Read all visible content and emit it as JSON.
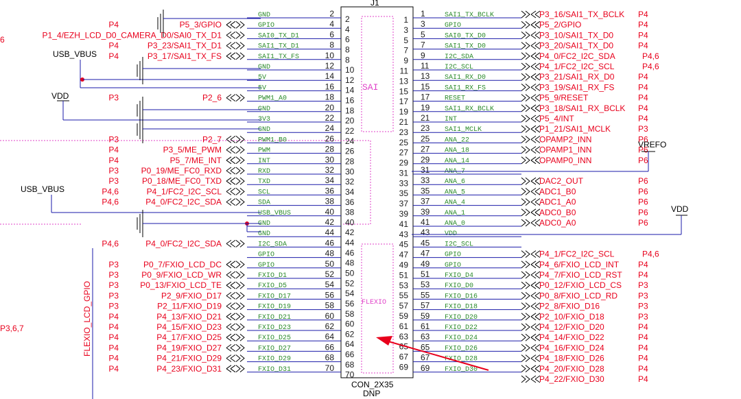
{
  "connector": {
    "designator": "J1",
    "part": "CON_2X35",
    "option": "DNP",
    "box_outer_pins": {
      "left": [
        2,
        4,
        6,
        8,
        10,
        12,
        14,
        16,
        18,
        20,
        22,
        24,
        26,
        28,
        30,
        32,
        34,
        36,
        38,
        40,
        42,
        44,
        46,
        48,
        50,
        52,
        54,
        56,
        58,
        60,
        62,
        64,
        66,
        68,
        70
      ],
      "right": [
        1,
        3,
        5,
        7,
        9,
        11,
        13,
        15,
        17,
        19,
        21,
        23,
        25,
        27,
        29,
        31,
        33,
        35,
        37,
        39,
        41,
        43,
        45,
        47,
        49,
        51,
        53,
        55,
        57,
        59,
        61,
        63,
        65,
        67,
        69
      ]
    },
    "box_inner_pins": {
      "left": [
        2,
        4,
        6,
        8,
        8,
        10,
        12,
        14,
        16,
        18,
        20,
        22,
        24,
        26,
        28,
        30,
        32,
        34,
        36,
        38,
        40,
        42,
        44,
        46,
        48,
        50,
        52,
        54,
        56,
        58,
        60,
        62,
        64,
        66,
        68,
        70
      ],
      "right": [
        1,
        3,
        5,
        7,
        9,
        11,
        13,
        15,
        17,
        19,
        21,
        23,
        25,
        27,
        29,
        31,
        33,
        35,
        37,
        39,
        41,
        43,
        45,
        47,
        49,
        51,
        53,
        55,
        57,
        59,
        61,
        63,
        65,
        67,
        69
      ]
    },
    "groups": {
      "sai": "SAI",
      "flexio": "FLEXIO"
    }
  },
  "rails": {
    "usb_vbus_1": "USB_VBUS",
    "vdd_1": "VDD",
    "usb_vbus_2": "USB_VBUS",
    "vdd_2": "VDD",
    "vrefo": "VREFO",
    "flexio_bus": "FLEXIO_LCD_GPIO",
    "far_left_page": "P3,6,7",
    "far_left_frag": "6"
  },
  "left_rows": [
    {
      "pin": "2",
      "net": "GND",
      "label": "",
      "page": "",
      "conn": false
    },
    {
      "pin": "4",
      "net": "GPIO",
      "label": "P5_3/GPIO",
      "page": "P4",
      "conn": true
    },
    {
      "pin": "6",
      "net": "SAI0_TX_D1",
      "label": "P1_4/EZH_LCD_D0_CAMERA_D0/SAI0_TX_D1",
      "page": "",
      "conn": true
    },
    {
      "pin": "8",
      "net": "SAI1_TX_D1",
      "label": "P3_23/SAI1_TX_D1",
      "page": "P4",
      "conn": true
    },
    {
      "pin": "10",
      "net": "SAI1_TX_FS",
      "label": "P3_17/SAI1_TX_FS",
      "page": "P4",
      "conn": true
    },
    {
      "pin": "12",
      "net": "GND",
      "label": "",
      "page": "",
      "conn": false
    },
    {
      "pin": "14",
      "net": "5V",
      "label": "",
      "page": "",
      "conn": false
    },
    {
      "pin": "16",
      "net": "5V",
      "label": "",
      "page": "",
      "conn": false
    },
    {
      "pin": "18",
      "net": "PWM1_A0",
      "label": "P2_6",
      "page": "P3",
      "conn": true
    },
    {
      "pin": "20",
      "net": "GND",
      "label": "",
      "page": "",
      "conn": false
    },
    {
      "pin": "22",
      "net": "3V3",
      "label": "",
      "page": "",
      "conn": false
    },
    {
      "pin": "24",
      "net": "GND",
      "label": "",
      "page": "",
      "conn": false
    },
    {
      "pin": "26",
      "net": "PWM1_B0",
      "label": "P2_7",
      "page": "P3",
      "conn": true
    },
    {
      "pin": "28",
      "net": "PWM",
      "label": "P3_5/ME_PWM",
      "page": "P4",
      "conn": true
    },
    {
      "pin": "30",
      "net": "INT",
      "label": "P5_7/ME_INT",
      "page": "P4",
      "conn": true
    },
    {
      "pin": "32",
      "net": "RXD",
      "label": "P0_19/ME_FC0_RXD",
      "page": "P3",
      "conn": true
    },
    {
      "pin": "34",
      "net": "TXD",
      "label": "P0_18/ME_FC0_TXD",
      "page": "P3",
      "conn": true
    },
    {
      "pin": "36",
      "net": "SCL",
      "label": "P4_1/FC2_I2C_SCL",
      "page": "P4,6",
      "conn": true
    },
    {
      "pin": "38",
      "net": "SDA",
      "label": "P4_0/FC2_I2C_SDA",
      "page": "P4,6",
      "conn": true
    },
    {
      "pin": "40",
      "net": "USB_VBUS",
      "label": "",
      "page": "",
      "conn": false
    },
    {
      "pin": "42",
      "net": "GND",
      "label": "",
      "page": "",
      "conn": false
    },
    {
      "pin": "44",
      "net": "GND",
      "label": "",
      "page": "",
      "conn": false
    },
    {
      "pin": "46",
      "net": "I2C_SDA",
      "label": "P4_0/FC2_I2C_SDA",
      "page": "P4,6",
      "conn": true
    },
    {
      "pin": "48",
      "net": "GPIO",
      "label": "",
      "page": "",
      "conn": false
    },
    {
      "pin": "50",
      "net": "GPIO",
      "label": "P0_7/FXIO_LCD_DC",
      "page": "P3",
      "conn": true
    },
    {
      "pin": "52",
      "net": "FXIO_D1",
      "label": "P0_9/FXIO_LCD_WR",
      "page": "P3",
      "conn": true
    },
    {
      "pin": "54",
      "net": "FXIO_D5",
      "label": "P0_13/FXIO_LCD_TE",
      "page": "P3",
      "conn": true
    },
    {
      "pin": "56",
      "net": "FXIO_D17",
      "label": "P2_9/FXIO_D17",
      "page": "P3",
      "conn": true
    },
    {
      "pin": "58",
      "net": "FXIO_D19",
      "label": "P2_11/FXIO_D19",
      "page": "P3",
      "conn": true
    },
    {
      "pin": "60",
      "net": "FXIO_D21",
      "label": "P4_13/FXIO_D21",
      "page": "P4",
      "conn": true
    },
    {
      "pin": "62",
      "net": "FXIO_D23",
      "label": "P4_15/FXIO_D23",
      "page": "P4",
      "conn": true
    },
    {
      "pin": "64",
      "net": "FXIO_D25",
      "label": "P4_17/FXIO_D25",
      "page": "P4",
      "conn": true
    },
    {
      "pin": "66",
      "net": "FXIO_D27",
      "label": "P4_19/FXIO_D27",
      "page": "P4",
      "conn": true
    },
    {
      "pin": "68",
      "net": "FXIO_D29",
      "label": "P4_21/FXIO_D29",
      "page": "P4",
      "conn": true
    },
    {
      "pin": "70",
      "net": "FXIO_D31",
      "label": "P4_23/FXIO_D31",
      "page": "P4",
      "conn": true
    }
  ],
  "right_rows": [
    {
      "pin": "1",
      "net": "SAI1_TX_BCLK",
      "label": "P3_16/SAI1_TX_BCLK",
      "page": "P4",
      "conn": true
    },
    {
      "pin": "3",
      "net": "GPIO",
      "label": "P5_2/GPIO",
      "page": "P4",
      "conn": true
    },
    {
      "pin": "5",
      "net": "SAI0_TX_D0",
      "label": "P3_10/SAI1_TX_D0",
      "page": "P4",
      "conn": true
    },
    {
      "pin": "7",
      "net": "SAI1_TX_D0",
      "label": "P3_20/SAI1_TX_D0",
      "page": "P4",
      "conn": true
    },
    {
      "pin": "9",
      "net": "I2C_SDA",
      "label": "P4_0/FC2_I2C_SDA",
      "page": "P4,6",
      "conn": true
    },
    {
      "pin": "11",
      "net": "I2C_SCL",
      "label": "P4_1/FC2_I2C_SCL",
      "page": "P4,6",
      "conn": true
    },
    {
      "pin": "13",
      "net": "SAI1_RX_D0",
      "label": "P3_21/SAI1_RX_D0",
      "page": "P4",
      "conn": true
    },
    {
      "pin": "15",
      "net": "SAI1_RX_FS",
      "label": "P3_19/SAI1_RX_FS",
      "page": "P4",
      "conn": true
    },
    {
      "pin": "17",
      "net": "RESET",
      "label": "P5_9/RESET",
      "page": "P4",
      "conn": true
    },
    {
      "pin": "19",
      "net": "SAI1_RX_BCLK",
      "label": "P3_18/SAI1_RX_BCLK",
      "page": "P4",
      "conn": true
    },
    {
      "pin": "21",
      "net": "INT",
      "label": "P5_4/INT",
      "page": "P4",
      "conn": true
    },
    {
      "pin": "23",
      "net": "SAI1_MCLK",
      "label": "P1_21/SAI1_MCLK",
      "page": "P3",
      "conn": true
    },
    {
      "pin": "25",
      "net": "ANA_22",
      "label": "OPAMP2_INN",
      "page": "P6",
      "conn": true
    },
    {
      "pin": "27",
      "net": "ANA_18",
      "label": "OPAMP1_INN",
      "page": "P6",
      "conn": true
    },
    {
      "pin": "29",
      "net": "ANA_14",
      "label": "OPAMP0_INN",
      "page": "P6",
      "conn": true
    },
    {
      "pin": "31",
      "net": "ANA_7",
      "label": "",
      "page": "",
      "conn": false
    },
    {
      "pin": "33",
      "net": "ANA_6",
      "label": "DAC2_OUT",
      "page": "P6",
      "conn": true
    },
    {
      "pin": "35",
      "net": "ANA_5",
      "label": "ADC1_B0",
      "page": "P6",
      "conn": true
    },
    {
      "pin": "37",
      "net": "ANA_4",
      "label": "ADC1_A0",
      "page": "P6",
      "conn": true
    },
    {
      "pin": "39",
      "net": "ANA_1",
      "label": "ADC0_B0",
      "page": "P6",
      "conn": true
    },
    {
      "pin": "41",
      "net": "ANA_0",
      "label": "ADC0_A0",
      "page": "P6",
      "conn": true
    },
    {
      "pin": "43",
      "net": "VDD",
      "label": "",
      "page": "",
      "conn": false
    },
    {
      "pin": "45",
      "net": "I2C_SCL",
      "label": "",
      "page": "",
      "conn": false
    },
    {
      "pin": "47",
      "net": "GPIO",
      "label": "P4_1/FC2_I2C_SCL",
      "page": "P4,6",
      "conn": true
    },
    {
      "pin": "49",
      "net": "GPIO",
      "label": "P4_6/FXIO_LCD_INT",
      "page": "P4",
      "conn": true
    },
    {
      "pin": "51",
      "net": "FXIO_D4",
      "label": "P4_7/FXIO_LCD_RST",
      "page": "P4",
      "conn": true
    },
    {
      "pin": "53",
      "net": "FXIO_D0",
      "label": "P0_12/FXIO_LCD_CS",
      "page": "P3",
      "conn": true
    },
    {
      "pin": "55",
      "net": "FXIO_D16",
      "label": "P0_8/FXIO_LCD_RD",
      "page": "P3",
      "conn": true
    },
    {
      "pin": "57",
      "net": "FXIO_D18",
      "label": "P2_8/FXIO_D16",
      "page": "P3",
      "conn": true
    },
    {
      "pin": "59",
      "net": "FXIO_D20",
      "label": "P2_10/FXIO_D18",
      "page": "P3",
      "conn": true
    },
    {
      "pin": "61",
      "net": "FXIO_D22",
      "label": "P4_12/FXIO_D20",
      "page": "P4",
      "conn": true
    },
    {
      "pin": "63",
      "net": "FXIO_D24",
      "label": "P4_14/FXIO_D22",
      "page": "P4",
      "conn": true
    },
    {
      "pin": "65",
      "net": "FXIO_D26",
      "label": "P4_16/FXIO_D24",
      "page": "P4",
      "conn": true
    },
    {
      "pin": "67",
      "net": "FXIO_D28",
      "label": "P4_18/FXIO_D26",
      "page": "P4",
      "conn": true
    },
    {
      "pin": "69",
      "net": "FXIO_D30",
      "label": "P4_20/FXIO_D28",
      "page": "P4",
      "conn": true
    },
    {
      "pin": "",
      "net": "",
      "label": "P4_22/FXIO_D30",
      "page": "P4",
      "conn": true
    }
  ],
  "colors": {
    "wire": "#1a1aa8",
    "label_red": "#e8001c",
    "net_green": "#2a8a2a",
    "group_box": "#e040c8",
    "annotation_arrow": "#e8001c"
  }
}
